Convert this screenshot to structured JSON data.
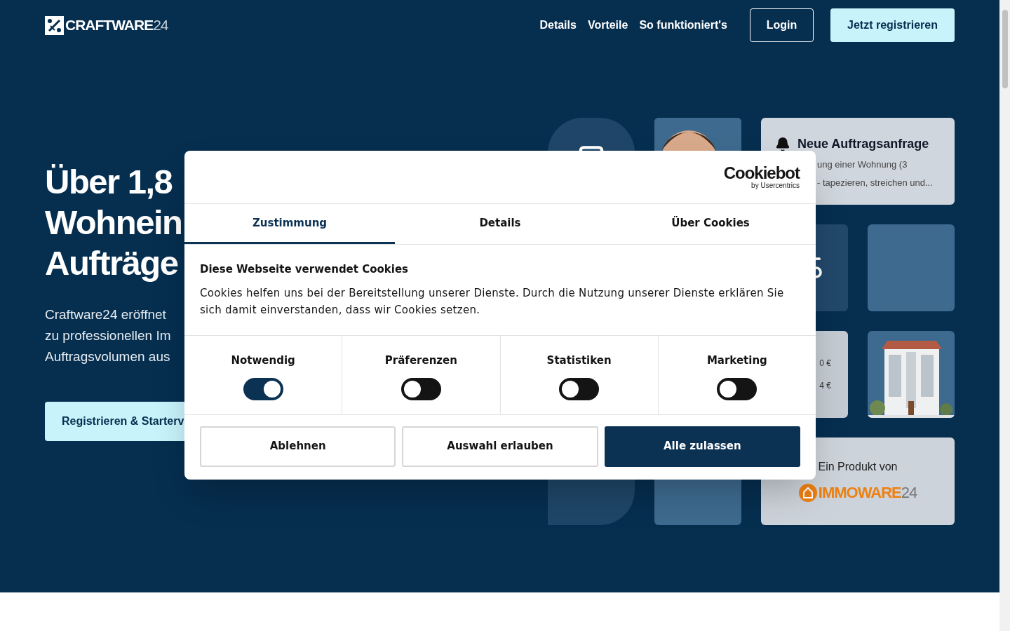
{
  "header": {
    "logo": {
      "name": "CRAFTWARE",
      "suffix": "24"
    },
    "nav": [
      "Details",
      "Vorteile",
      "So funktioniert's"
    ],
    "login": "Login",
    "register": "Jetzt registrieren"
  },
  "hero": {
    "heading": [
      "Über 1,8",
      "Wohnein",
      "Aufträge"
    ],
    "text": [
      "Craftware24 eröffnet",
      "zu professionellen Im",
      "Auftragsvolumen aus"
    ],
    "cta": "Registrieren & Starterv"
  },
  "cards": {
    "request": {
      "title": "Neue Auftragsanfrage",
      "lines": [
        "ung einer Wohnung (3",
        "- tapezieren, streichen und..."
      ]
    },
    "prices": [
      "0 €",
      "4 €"
    ],
    "product": {
      "label": "Ein Produkt von",
      "brand": "IMMOWARE",
      "suffix": "24"
    }
  },
  "cookie_dialog": {
    "brand": "Cookiebot",
    "brand_sub": "by Usercentrics",
    "tabs": [
      {
        "label": "Zustimmung",
        "selected": true
      },
      {
        "label": "Details",
        "selected": false
      },
      {
        "label": "Über Cookies",
        "selected": false
      }
    ],
    "title": "Diese Webseite verwendet Cookies",
    "text": "Cookies helfen uns bei der Bereitstellung unserer Dienste. Durch die Nutzung unserer Dienste erklären Sie sich damit einverstanden, dass wir Cookies setzen.",
    "categories": [
      {
        "label": "Notwendig",
        "checked": true
      },
      {
        "label": "Präferenzen",
        "checked": false
      },
      {
        "label": "Statistiken",
        "checked": false
      },
      {
        "label": "Marketing",
        "checked": false
      }
    ],
    "buttons": [
      {
        "label": "Ablehnen",
        "kind": "outline"
      },
      {
        "label": "Auswahl erlauben",
        "kind": "outline"
      },
      {
        "label": "Alle zulassen",
        "kind": "primary"
      }
    ]
  }
}
